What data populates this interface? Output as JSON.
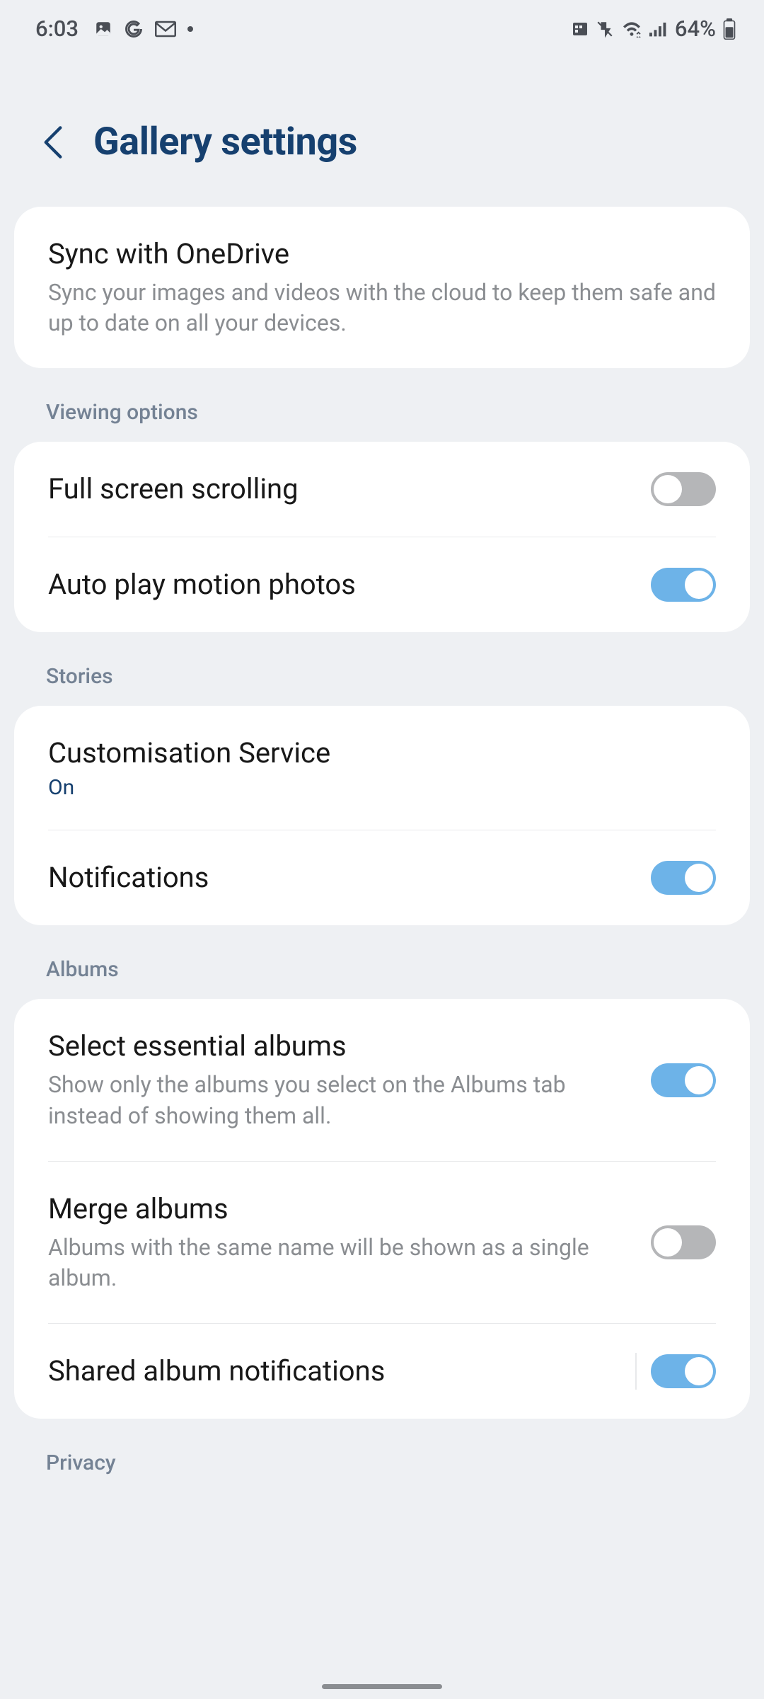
{
  "status": {
    "time": "6:03",
    "battery": "64%"
  },
  "header": {
    "title": "Gallery settings"
  },
  "sync": {
    "title": "Sync with OneDrive",
    "desc": "Sync your images and videos with the cloud to keep them safe and up to date on all your devices."
  },
  "sections": {
    "viewing": "Viewing options",
    "stories": "Stories",
    "albums": "Albums",
    "privacy": "Privacy"
  },
  "viewing": {
    "fullscreen": "Full screen scrolling",
    "autoplay": "Auto play motion photos"
  },
  "stories": {
    "customisation_title": "Customisation Service",
    "customisation_status": "On",
    "notifications": "Notifications"
  },
  "albums": {
    "select_title": "Select essential albums",
    "select_desc": "Show only the albums you select on the Albums tab instead of showing them all.",
    "merge_title": "Merge albums",
    "merge_desc": "Albums with the same name will be shown as a single album.",
    "shared": "Shared album notifications"
  },
  "toggles": {
    "fullscreen": false,
    "autoplay": true,
    "notifications": true,
    "select_albums": true,
    "merge_albums": false,
    "shared_notif": true
  }
}
